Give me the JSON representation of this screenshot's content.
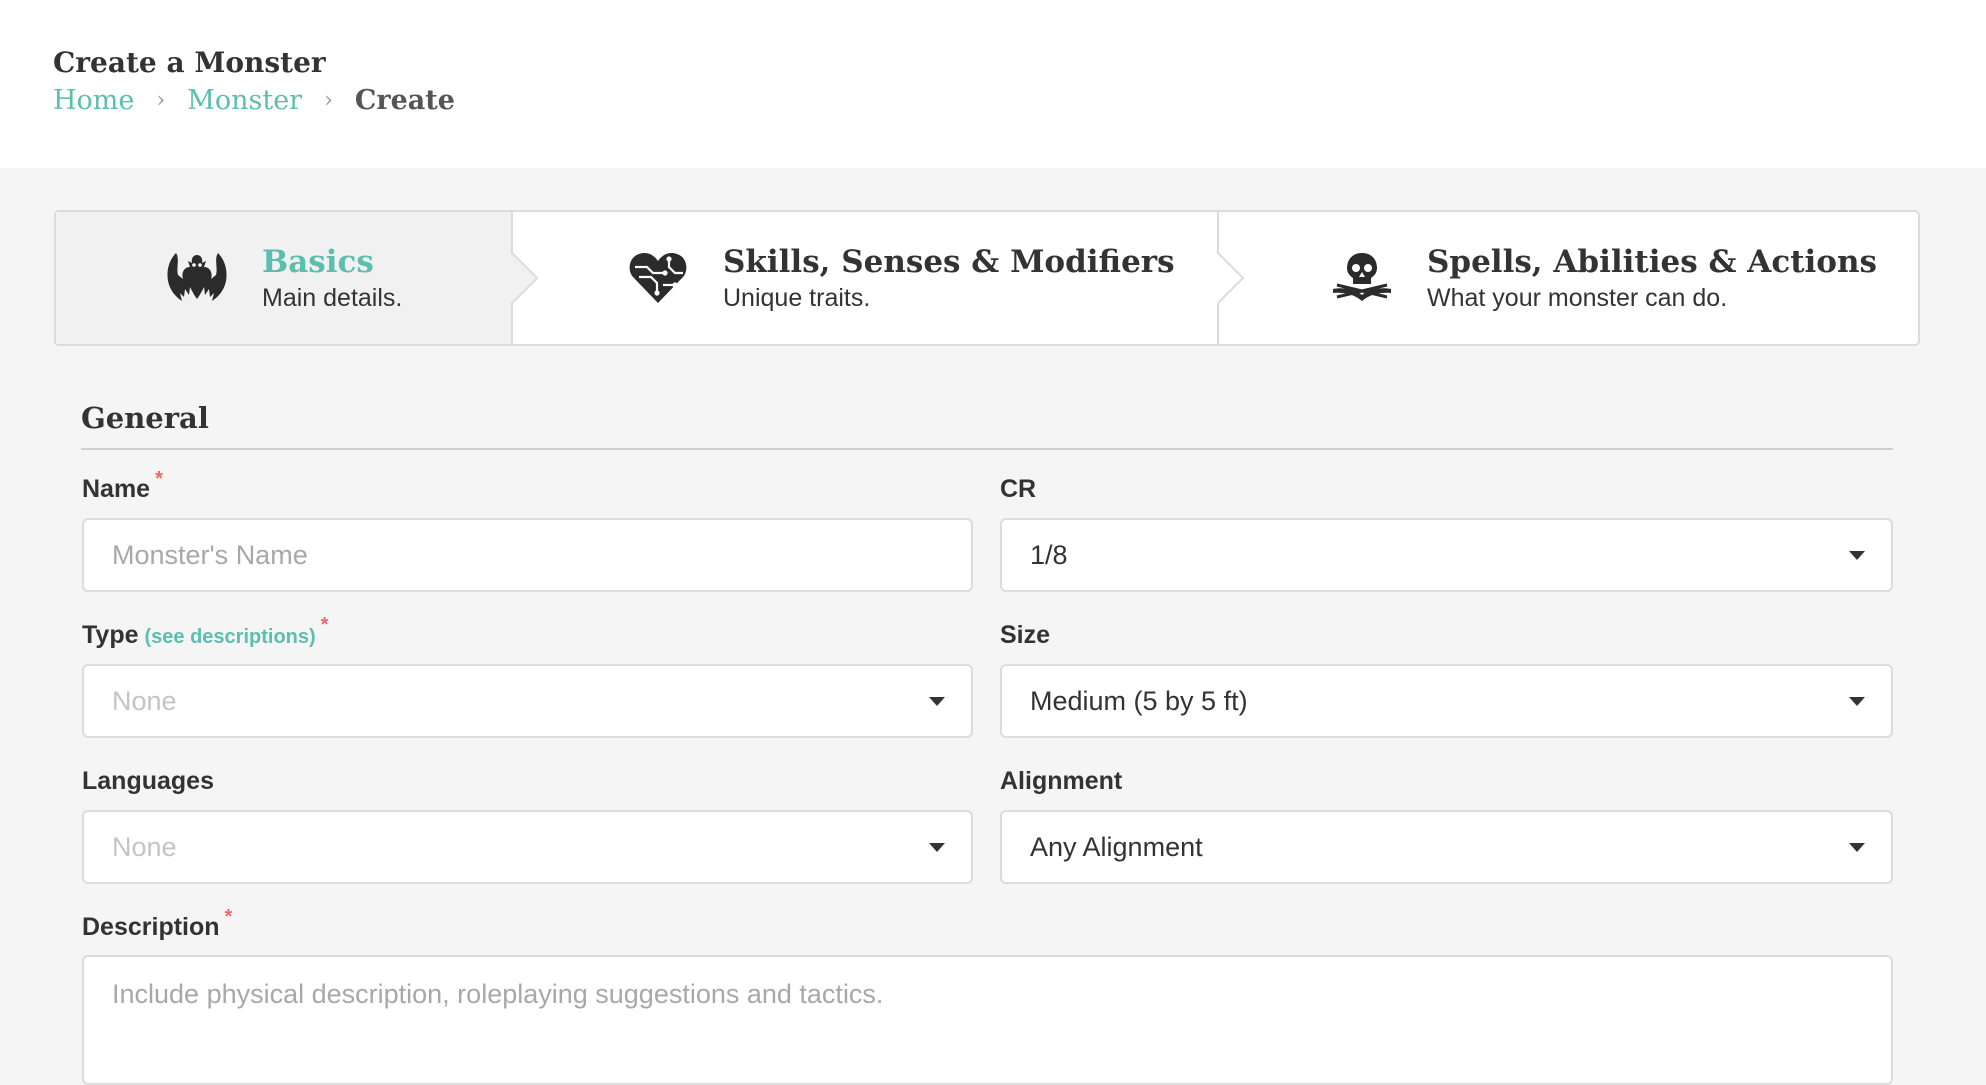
{
  "header": {
    "title": "Create a Monster",
    "breadcrumb": [
      {
        "label": "Home"
      },
      {
        "label": "Monster"
      },
      {
        "label": "Create"
      }
    ],
    "separator": "›"
  },
  "steps": [
    {
      "title": "Basics",
      "subtitle": "Main details.",
      "icon": "dragon-icon",
      "active": true
    },
    {
      "title": "Skills, Senses & Modifiers",
      "subtitle": "Unique traits.",
      "icon": "circuit-heart-icon",
      "active": false
    },
    {
      "title": "Spells, Abilities & Actions",
      "subtitle": "What your monster can do.",
      "icon": "skull-book-icon",
      "active": false
    }
  ],
  "form": {
    "section_title": "General",
    "required_mark": "*",
    "name": {
      "label": "Name",
      "placeholder": "Monster's Name",
      "value": ""
    },
    "cr": {
      "label": "CR",
      "value": "1/8"
    },
    "type": {
      "label": "Type",
      "link": "(see descriptions)",
      "value": "None"
    },
    "size": {
      "label": "Size",
      "value": "Medium (5 by 5 ft)"
    },
    "languages": {
      "label": "Languages",
      "value": "None"
    },
    "alignment": {
      "label": "Alignment",
      "value": "Any Alignment"
    },
    "description": {
      "label": "Description",
      "placeholder": "Include physical description, roleplaying suggestions and tactics."
    }
  },
  "colors": {
    "accent": "#5cbfae",
    "required": "#e86a6a"
  }
}
